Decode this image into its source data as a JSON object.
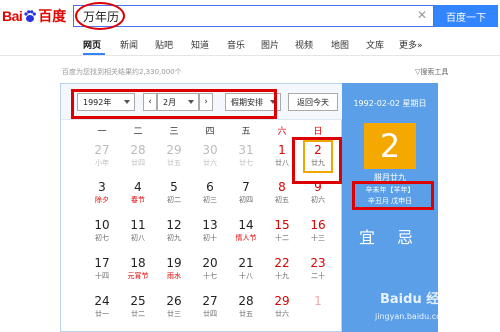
{
  "logo": {
    "text_left": "Bai",
    "text_right": "百度"
  },
  "search": {
    "value": "万年历",
    "clear": "✕",
    "button": "百度一下"
  },
  "tabs": [
    {
      "label": "网页",
      "active": true
    },
    {
      "label": "新闻"
    },
    {
      "label": "贴吧"
    },
    {
      "label": "知道"
    },
    {
      "label": "音乐"
    },
    {
      "label": "图片"
    },
    {
      "label": "视频"
    },
    {
      "label": "地图"
    },
    {
      "label": "文库"
    },
    {
      "label": "更多»"
    }
  ],
  "result_count": "百度为您找到相关结果约2,330,000个",
  "tools": "搜索工具",
  "calendar": {
    "year_select": "1992年",
    "month_select": "2月",
    "prev": "‹",
    "next": "›",
    "holiday_select": "假期安排",
    "today_button": "返回今天",
    "weekdays": [
      "一",
      "二",
      "三",
      "四",
      "五",
      "六",
      "日"
    ],
    "rows": [
      [
        {
          "num": "27",
          "lunar": "小年",
          "dim": true
        },
        {
          "num": "28",
          "lunar": "廿四",
          "dim": true
        },
        {
          "num": "29",
          "lunar": "廿五",
          "dim": true
        },
        {
          "num": "30",
          "lunar": "廿六",
          "dim": true
        },
        {
          "num": "31",
          "lunar": "廿七",
          "dim": true
        },
        {
          "num": "1",
          "lunar": "廿八",
          "red": true
        },
        {
          "num": "2",
          "lunar": "廿九",
          "red": true,
          "selected": true
        }
      ],
      [
        {
          "num": "3",
          "lunar": "除夕",
          "hol": true
        },
        {
          "num": "4",
          "lunar": "春节",
          "hol": true
        },
        {
          "num": "5",
          "lunar": "初二"
        },
        {
          "num": "6",
          "lunar": "初三"
        },
        {
          "num": "7",
          "lunar": "初四"
        },
        {
          "num": "8",
          "lunar": "初五",
          "red": true
        },
        {
          "num": "9",
          "lunar": "初六",
          "red": true
        }
      ],
      [
        {
          "num": "10",
          "lunar": "初七"
        },
        {
          "num": "11",
          "lunar": "初八"
        },
        {
          "num": "12",
          "lunar": "初九"
        },
        {
          "num": "13",
          "lunar": "初十"
        },
        {
          "num": "14",
          "lunar": "情人节",
          "hol": true
        },
        {
          "num": "15",
          "lunar": "十二",
          "red": true
        },
        {
          "num": "16",
          "lunar": "十三",
          "red": true
        }
      ],
      [
        {
          "num": "17",
          "lunar": "十四"
        },
        {
          "num": "18",
          "lunar": "元宵节",
          "hol": true
        },
        {
          "num": "19",
          "lunar": "雨水",
          "hol": true
        },
        {
          "num": "20",
          "lunar": "十七"
        },
        {
          "num": "21",
          "lunar": "十八"
        },
        {
          "num": "22",
          "lunar": "十九",
          "red": true
        },
        {
          "num": "23",
          "lunar": "二十",
          "red": true
        }
      ],
      [
        {
          "num": "24",
          "lunar": "廿一"
        },
        {
          "num": "25",
          "lunar": "廿二"
        },
        {
          "num": "26",
          "lunar": "廿三"
        },
        {
          "num": "27",
          "lunar": "廿四"
        },
        {
          "num": "28",
          "lunar": "廿五"
        },
        {
          "num": "29",
          "lunar": "廿六",
          "red": true
        },
        {
          "num": "1",
          "lunar": "",
          "dim": true,
          "red": true
        }
      ]
    ]
  },
  "side": {
    "date": "1992-02-02 星期日",
    "day": "2",
    "lunar": "腊月廿九",
    "ganzhi_year": "辛未年【羊年】",
    "ganzhi_day": "辛丑月 戊申日",
    "yi": "宜",
    "ji": "忌"
  },
  "watermark": {
    "brand": "Baidu 经验",
    "sub": "jingyan.baidu.com"
  },
  "colors": {
    "accent": "#3385ff",
    "highlight": "#f5a800",
    "side_bg": "#5b9fe8",
    "annotation_red": "#dd0000"
  }
}
